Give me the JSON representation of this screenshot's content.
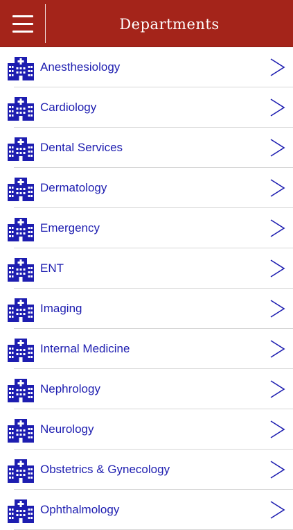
{
  "header": {
    "title": "Departments",
    "menu_icon": "hamburger-menu-icon",
    "background": "#a4241a"
  },
  "list": {
    "item_icon": "hospital-building-icon",
    "chevron_icon": "chevron-right-icon",
    "accent_color": "#1d1db0",
    "items": [
      {
        "label": "Anesthesiology"
      },
      {
        "label": "Cardiology"
      },
      {
        "label": "Dental Services"
      },
      {
        "label": "Dermatology"
      },
      {
        "label": "Emergency"
      },
      {
        "label": "ENT"
      },
      {
        "label": "Imaging"
      },
      {
        "label": "Internal Medicine"
      },
      {
        "label": "Nephrology"
      },
      {
        "label": "Neurology"
      },
      {
        "label": "Obstetrics & Gynecology"
      },
      {
        "label": "Ophthalmology"
      }
    ]
  }
}
